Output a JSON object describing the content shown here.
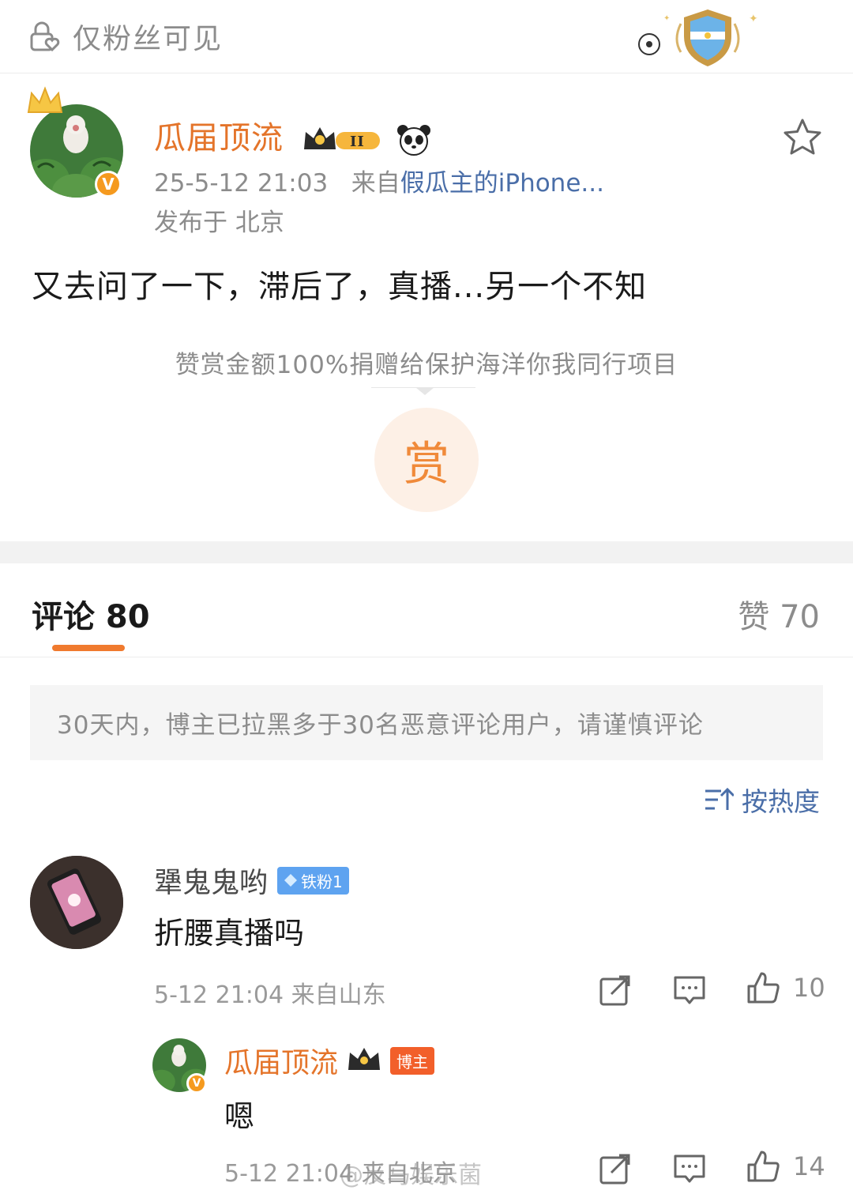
{
  "topbar": {
    "privacy_label": "仅粉丝可见"
  },
  "post": {
    "author": "瓜届顶流",
    "time": "25-5-12 21:03",
    "source_prefix": "来自",
    "source": "假瓜主的iPhone...",
    "location": "发布于 北京",
    "text": "又去问了一下，滞后了，真播...另一个不知",
    "reward_note": "赞赏金额100%捐赠给保护海洋你我同行项目",
    "reward_button": "赏"
  },
  "tabs": {
    "comments": "评论 80",
    "likes": "赞 70"
  },
  "notice": "30天内，博主已拉黑多于30名恶意评论用户，请谨慎评论",
  "sort": "按热度",
  "comments": [
    {
      "name": "犟鬼鬼哟",
      "badge": "铁粉1",
      "text": "折腰真播吗",
      "meta": "5-12 21:04  来自山东",
      "likes": "10"
    }
  ],
  "reply": {
    "name": "瓜届顶流",
    "badge": "博主",
    "text": "嗯",
    "meta": "5-12 21:04  来自北京",
    "likes": "14"
  },
  "watermark": "@反马娱乐菌",
  "colors": {
    "accent_orange": "#e4742a",
    "link_blue": "#4a6ea8",
    "muted_gray": "#8c8c8c"
  }
}
